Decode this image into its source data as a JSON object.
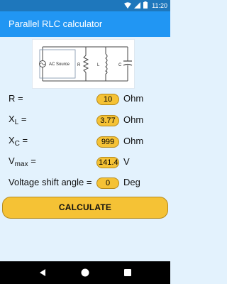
{
  "status_bar": {
    "time": "11:20",
    "icons": [
      "wifi-icon",
      "signal-icon",
      "battery-icon"
    ]
  },
  "app_bar": {
    "title": "Parallel RLC calculator"
  },
  "diagram": {
    "source_label": "AC Source",
    "r_label": "R",
    "l_label": "L",
    "c_label": "C"
  },
  "inputs": {
    "r": {
      "label": "R =",
      "value": "10",
      "unit": "Ohm"
    },
    "xl": {
      "label_main": "X",
      "label_sub": "L",
      "label_suffix": " =",
      "value": "3.77",
      "unit": "Ohm"
    },
    "xc": {
      "label_main": "X",
      "label_sub": "C",
      "label_suffix": " =",
      "value": "999",
      "unit": "Ohm"
    },
    "vmax": {
      "label_main": "V",
      "label_sub": "max",
      "label_suffix": " =",
      "value": "141.4",
      "unit": "V"
    },
    "shift": {
      "label": "Voltage shift angle =",
      "value": "0",
      "unit": "Deg"
    }
  },
  "calculate_button": {
    "label": "CALCULATE"
  },
  "colors": {
    "status_bar": "#1e77bc",
    "app_bar": "#2196f3",
    "background": "#e3f2fd",
    "field": "#f5c235",
    "button": "#f5c235"
  },
  "nav_bar": {
    "icons": [
      "back-icon",
      "home-icon",
      "recents-icon"
    ]
  }
}
